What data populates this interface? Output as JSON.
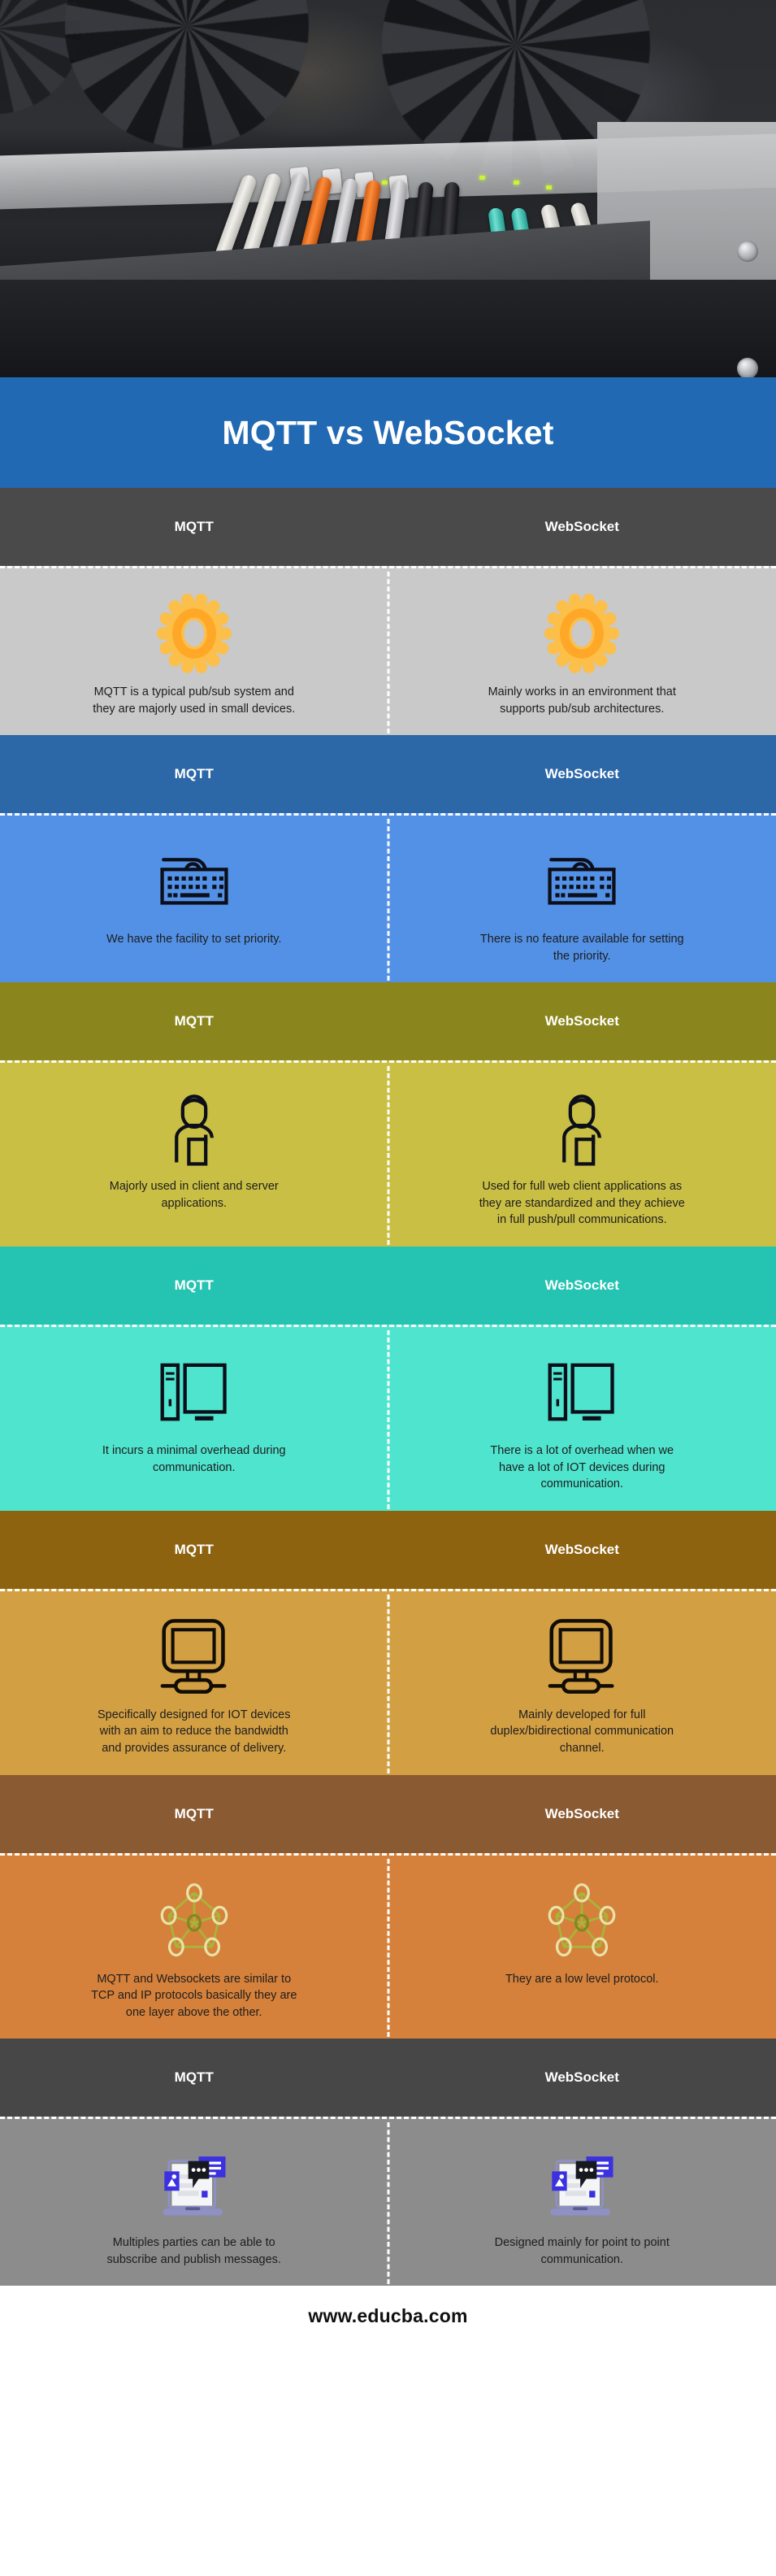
{
  "title": "MQTT vs WebSocket",
  "footer": {
    "url": "www.educba.com"
  },
  "colors": {
    "title_band": "#2169b3",
    "gear_outer": "#fbbf4a",
    "gear_inner": "#ffa726",
    "divider": "#ffffff"
  },
  "hero": {
    "alt": "network-switch-with-ethernet-and-fiber-cables-photo"
  },
  "column_labels": {
    "left": "MQTT",
    "right": "WebSocket"
  },
  "sections": [
    {
      "id": "pubsub",
      "header_bg": "#4a4a4a",
      "body_bg": "#c9c9c9",
      "icon": "gear-icon",
      "left_label": "MQTT",
      "right_label": "WebSocket",
      "left_text": "MQTT is a typical pub/sub system and they are majorly used in small devices.",
      "right_text": "Mainly works in an environment that supports pub/sub architectures."
    },
    {
      "id": "priority",
      "header_bg": "#2c67a8",
      "body_bg": "#5391e6",
      "icon": "keyboard-icon",
      "left_label": "MQTT",
      "right_label": "WebSocket",
      "left_text": "We have the facility to set priority.",
      "right_text": "There is no feature available for setting the priority."
    },
    {
      "id": "applications",
      "header_bg": "#8a861d",
      "body_bg": "#c9bf45",
      "icon": "person-icon",
      "left_label": "MQTT",
      "right_label": "WebSocket",
      "left_text": "Majorly used in client and server applications.",
      "right_text": "Used for full web client applications as they are standardized and they achieve in full push/pull communications."
    },
    {
      "id": "overhead",
      "header_bg": "#25c3b2",
      "body_bg": "#4fe4ce",
      "icon": "desktop-tower-icon",
      "left_label": "MQTT",
      "right_label": "WebSocket",
      "left_text": "It incurs a minimal overhead during communication.",
      "right_text": "There is a lot of overhead when we have a lot of IOT devices during communication."
    },
    {
      "id": "design-purpose",
      "header_bg": "#8d6310",
      "body_bg": "#d39f43",
      "icon": "monitor-icon",
      "left_label": "MQTT",
      "right_label": "WebSocket",
      "left_text": "Specifically designed for IOT devices with an aim to reduce the bandwidth and provides assurance of delivery.",
      "right_text": "Mainly developed for full duplex/bidirectional communication channel."
    },
    {
      "id": "protocol-layer",
      "header_bg": "#8a5a33",
      "body_bg": "#d5813b",
      "icon": "network-nodes-icon",
      "left_label": "MQTT",
      "right_label": "WebSocket",
      "left_text": "MQTT and Websockets are similar to TCP and IP protocols basically they are one layer above the other.",
      "right_text": "They are a low level protocol."
    },
    {
      "id": "messaging",
      "header_bg": "#474747",
      "body_bg": "#8c8c8c",
      "icon": "laptop-chat-icon",
      "left_label": "MQTT",
      "right_label": "WebSocket",
      "left_text": "Multiples parties can be able to subscribe and publish messages.",
      "right_text": "Designed mainly for point to point communication."
    }
  ]
}
